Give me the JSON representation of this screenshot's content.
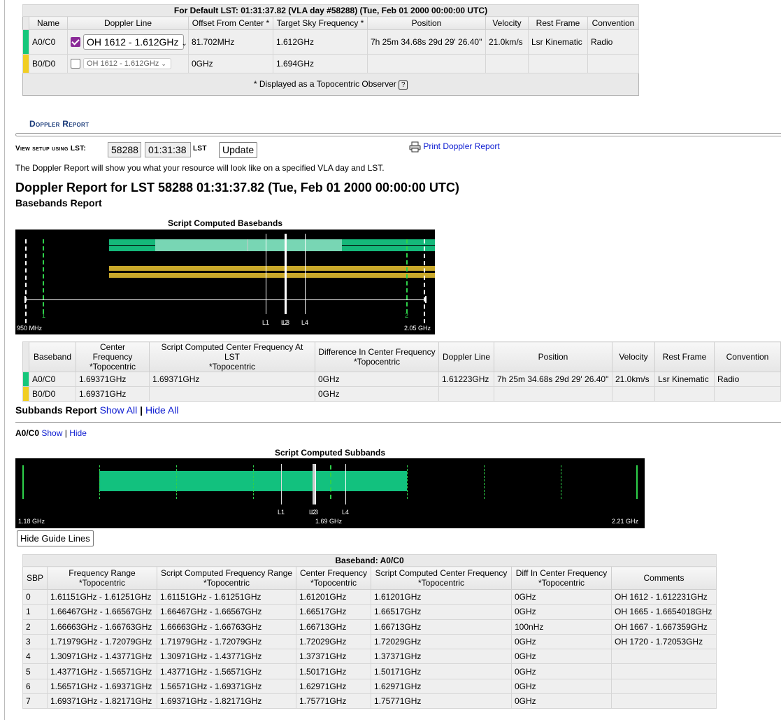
{
  "top_table": {
    "caption": "For Default LST: 01:31:37.82 (VLA day #58288) (Tue, Feb 01 2000 00:00:00 UTC)",
    "headers": [
      "Name",
      "Doppler Line",
      "Offset From Center *",
      "Target Sky Frequency *",
      "Position",
      "Velocity",
      "Rest Frame",
      "Convention"
    ],
    "rows": [
      {
        "name": "A0/C0",
        "checked": true,
        "line": "OH 1612 - 1.612GHz",
        "offset": "81.702MHz",
        "target": "1.612GHz",
        "position": "7h 25m 34.68s 29d 29' 26.40\"",
        "velocity": "21.0km/s",
        "rest_frame": "Lsr Kinematic",
        "convention": "Radio",
        "color": "#15c77b"
      },
      {
        "name": "B0/D0",
        "checked": false,
        "line": "OH 1612 - 1.612GHz",
        "offset": "0GHz",
        "target": "1.694GHz",
        "position": "",
        "velocity": "",
        "rest_frame": "",
        "convention": "",
        "color": "#f1ce23"
      }
    ],
    "footnote": "* Displayed as a Topocentric Observer",
    "help": "?"
  },
  "doppler_report": {
    "section_title": "Doppler Report",
    "view_label": "View setup using LST:",
    "day_value": "58288",
    "time_value": "01:31:38",
    "lst_label": "LST",
    "update_button": "Update",
    "print_link": "Print Doppler Report",
    "description": "The Doppler Report will show you what your resource will look like on a specified VLA day and LST.",
    "heading": "Doppler Report for LST 58288 01:31:37.82 (Tue, Feb 01 2000 00:00:00 UTC)",
    "baseband_heading": "Basebands Report"
  },
  "baseband_chart": {
    "title": "Script Computed Basebands",
    "x_min_label": "950 MHz",
    "x_max_label": "2.05 GHz",
    "line_labels": [
      "L1",
      "L2",
      "L3",
      "L4"
    ],
    "guide_labels": [
      "1",
      "2"
    ]
  },
  "baseband_table": {
    "headers": [
      [
        "Baseband",
        ""
      ],
      [
        "Center Frequency",
        "*Topocentric"
      ],
      [
        "Script Computed Center Frequency At LST",
        "*Topocentric"
      ],
      [
        "Difference In Center Frequency",
        "*Topocentric"
      ],
      [
        "Doppler Line",
        ""
      ],
      [
        "Position",
        ""
      ],
      [
        "Velocity",
        ""
      ],
      [
        "Rest Frame",
        ""
      ],
      [
        "Convention",
        ""
      ]
    ],
    "rows": [
      {
        "name": "A0/C0",
        "center": "1.69371GHz",
        "script_center": "1.69371GHz",
        "diff": "0GHz",
        "line": "1.61223GHz",
        "position": "7h 25m 34.68s 29d 29' 26.40\"",
        "velocity": "21.0km/s",
        "rest_frame": "Lsr Kinematic",
        "convention": "Radio"
      },
      {
        "name": "B0/D0",
        "center": "1.69371GHz",
        "script_center": "",
        "diff": "0GHz",
        "line": "",
        "position": "",
        "velocity": "",
        "rest_frame": "",
        "convention": ""
      }
    ]
  },
  "subbands": {
    "heading": "Subbands Report",
    "show_all": "Show All",
    "sep": "|",
    "hide_all": "Hide All",
    "bb_label": "A0/C0",
    "show": "Show",
    "hide": "Hide",
    "hide_guides_button": "Hide Guide Lines"
  },
  "subband_chart": {
    "title": "Script Computed Subbands",
    "x_min_label": "1.18 GHz",
    "x_mid_label": "1.69 GHz",
    "x_max_label": "2.21 GHz",
    "line_labels": [
      "L1",
      "L2",
      "L3",
      "L4"
    ]
  },
  "sbp_table": {
    "caption": "Baseband: A0/C0",
    "headers": [
      [
        "SBP",
        ""
      ],
      [
        "Frequency Range",
        "*Topocentric"
      ],
      [
        "Script Computed Frequency Range",
        "*Topocentric"
      ],
      [
        "Center Frequency",
        "*Topocentric"
      ],
      [
        "Script Computed Center Frequency",
        "*Topocentric"
      ],
      [
        "Diff In Center Frequency",
        "*Topocentric"
      ],
      [
        "Comments",
        ""
      ]
    ],
    "rows": [
      [
        "0",
        "1.61151GHz - 1.61251GHz",
        "1.61151GHz - 1.61251GHz",
        "1.61201GHz",
        "1.61201GHz",
        "0GHz",
        "OH 1612 - 1.612231GHz"
      ],
      [
        "1",
        "1.66467GHz - 1.66567GHz",
        "1.66467GHz - 1.66567GHz",
        "1.66517GHz",
        "1.66517GHz",
        "0GHz",
        "OH 1665 - 1.6654018GHz"
      ],
      [
        "2",
        "1.66663GHz - 1.66763GHz",
        "1.66663GHz - 1.66763GHz",
        "1.66713GHz",
        "1.66713GHz",
        "100nHz",
        "OH 1667 - 1.667359GHz"
      ],
      [
        "3",
        "1.71979GHz - 1.72079GHz",
        "1.71979GHz - 1.72079GHz",
        "1.72029GHz",
        "1.72029GHz",
        "0GHz",
        "OH 1720 - 1.72053GHz"
      ],
      [
        "4",
        "1.30971GHz - 1.43771GHz",
        "1.30971GHz - 1.43771GHz",
        "1.37371GHz",
        "1.37371GHz",
        "0GHz",
        ""
      ],
      [
        "5",
        "1.43771GHz - 1.56571GHz",
        "1.43771GHz - 1.56571GHz",
        "1.50171GHz",
        "1.50171GHz",
        "0GHz",
        ""
      ],
      [
        "6",
        "1.56571GHz - 1.69371GHz",
        "1.56571GHz - 1.69371GHz",
        "1.62971GHz",
        "1.62971GHz",
        "0GHz",
        ""
      ],
      [
        "7",
        "1.69371GHz - 1.82171GHz",
        "1.69371GHz - 1.82171GHz",
        "1.75771GHz",
        "1.75771GHz",
        "0GHz",
        ""
      ]
    ]
  }
}
